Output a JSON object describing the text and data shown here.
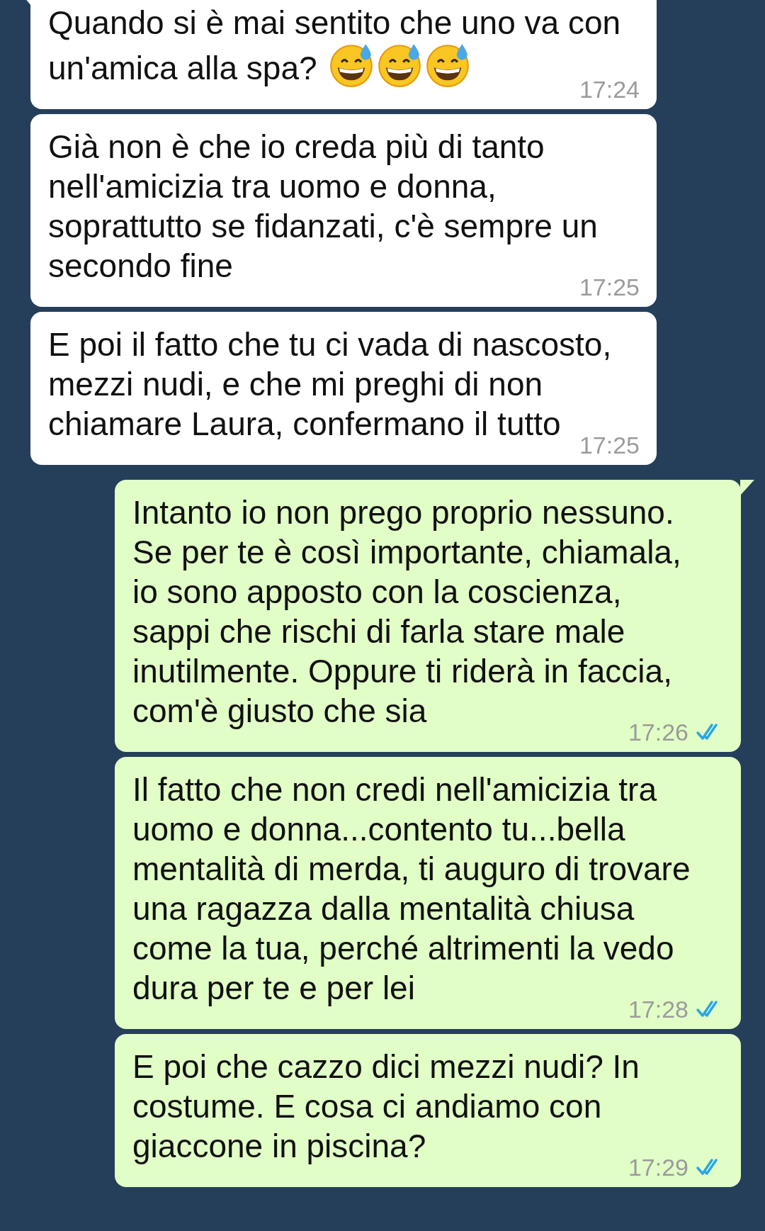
{
  "messages": [
    {
      "outgoing": false,
      "tail": true,
      "text": "Quando si è mai sentito che uno va con\nun'amica alla spa?",
      "emoji": [
        {
          "kind": "grin-sweat"
        },
        {
          "kind": "grin-sweat"
        },
        {
          "kind": "grin-sweat"
        }
      ],
      "time": "17:24"
    },
    {
      "outgoing": false,
      "tail": false,
      "text": "Già non è che io creda più di tanto\nnell'amicizia tra uomo e donna,\nsoprattutto se fidanzati, c'è sempre un\nsecondo fine",
      "time": "17:25"
    },
    {
      "outgoing": false,
      "tail": false,
      "text": "E poi il fatto che tu ci vada di nascosto,\nmezzi nudi, e che mi preghi di non\nchiamare Laura, confermano il tutto",
      "time": "17:25"
    },
    {
      "outgoing": true,
      "tail": true,
      "text": "Intanto io non prego proprio nessuno.\nSe per te è così importante, chiamala,\nio sono apposto con la coscienza,\nsappi che rischi di farla stare male\ninutilmente. Oppure ti riderà in faccia,\ncom'è giusto che sia",
      "time": "17:26",
      "read": true
    },
    {
      "outgoing": true,
      "tail": false,
      "text": "Il fatto che non credi nell'amicizia tra\nuomo e donna...contento tu...bella\nmentalità di merda, ti auguro di trovare\nuna ragazza dalla mentalità chiusa\ncome la tua, perché altrimenti la vedo\ndura per te e per lei",
      "time": "17:28",
      "read": true
    },
    {
      "outgoing": true,
      "tail": false,
      "text": "E poi che cazzo dici mezzi nudi? In\ncostume. E cosa ci andiamo con\ngiaccone in piscina?",
      "time": "17:29",
      "read": true
    }
  ]
}
